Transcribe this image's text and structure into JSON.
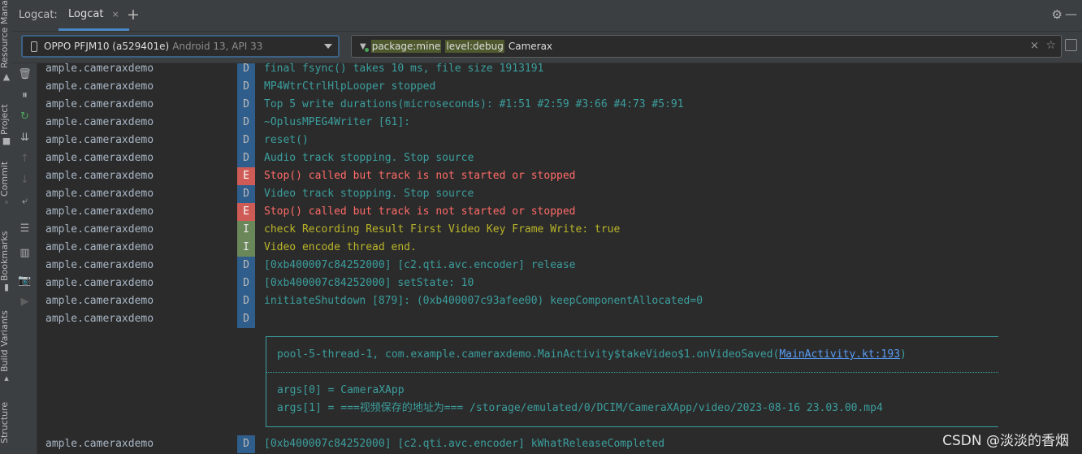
{
  "left_strip": {
    "labels": [
      "Resource Manager",
      "Project",
      "Commit",
      "Bookmarks",
      "Build Variants",
      "Structure"
    ]
  },
  "topbar": {
    "title": "Logcat:",
    "tab_label": "Logcat",
    "tab_close": "×",
    "add": "+",
    "settings_glyph": "⚙",
    "minimize_glyph": "—"
  },
  "device": {
    "name": "OPPO PFJM10 (a529401e)",
    "api": "Android 13, API 33"
  },
  "filter": {
    "chips": [
      "package:mine",
      "level:debug"
    ],
    "text": "Camerax",
    "clear_glyph": "×",
    "star_glyph": "☆"
  },
  "tools": [
    "🗑",
    "⏸",
    "↻",
    "⇊",
    "↑",
    "↓",
    "⤶",
    "☰",
    "▥",
    "📷",
    "▶"
  ],
  "log": {
    "rows": [
      {
        "pkg": "ample.cameraxdemo",
        "level": "D",
        "msg": "final fsync() takes 10 ms, file size 1913191"
      },
      {
        "pkg": "ample.cameraxdemo",
        "level": "D",
        "msg": "MP4WtrCtrlHlpLooper stopped"
      },
      {
        "pkg": "ample.cameraxdemo",
        "level": "D",
        "msg": "Top 5 write durations(microseconds): #1:51 #2:59 #3:66 #4:73 #5:91"
      },
      {
        "pkg": "ample.cameraxdemo",
        "level": "D",
        "msg": "~OplusMPEG4Writer [61]:"
      },
      {
        "pkg": "ample.cameraxdemo",
        "level": "D",
        "msg": "reset()"
      },
      {
        "pkg": "ample.cameraxdemo",
        "level": "D",
        "msg": "Audio track stopping. Stop source"
      },
      {
        "pkg": "ample.cameraxdemo",
        "level": "E",
        "msg": "Stop() called but track is not started or stopped"
      },
      {
        "pkg": "ample.cameraxdemo",
        "level": "D",
        "msg": "Video track stopping. Stop source"
      },
      {
        "pkg": "ample.cameraxdemo",
        "level": "E",
        "msg": "Stop() called but track is not started or stopped"
      },
      {
        "pkg": "ample.cameraxdemo",
        "level": "I",
        "msg": "check Recording Result First Video Key Frame Write: true"
      },
      {
        "pkg": "ample.cameraxdemo",
        "level": "I",
        "msg": "Video encode thread end."
      },
      {
        "pkg": "ample.cameraxdemo",
        "level": "D",
        "msg": "[0xb400007c84252000] [c2.qti.avc.encoder] release"
      },
      {
        "pkg": "ample.cameraxdemo",
        "level": "D",
        "msg": "[0xb400007c84252000] setState: 10"
      },
      {
        "pkg": "ample.cameraxdemo",
        "level": "D",
        "msg": "initiateShutdown [879]: (0xb400007c93afee00) keepComponentAllocated=0"
      },
      {
        "pkg": "ample.cameraxdemo",
        "level": "D",
        "msg": ""
      }
    ],
    "box": {
      "thread_line_prefix": "pool-5-thread-1, com.example.cameraxdemo.MainActivity$takeVideo$1.onVideoSaved(",
      "link": "MainActivity.kt:193",
      "thread_line_suffix": ")",
      "arg0": "args[0] = CameraXApp",
      "arg1": "args[1] = ===视频保存的地址为=== /storage/emulated/0/DCIM/CameraXApp/video/2023-08-16 23.03.00.mp4"
    },
    "last_row": {
      "pkg": "ample.cameraxdemo",
      "level": "D",
      "msg": "[0xb400007c84252000] [c2.qti.avc.encoder] kWhatReleaseCompleted"
    }
  },
  "watermark": "CSDN @淡淡的香烟"
}
